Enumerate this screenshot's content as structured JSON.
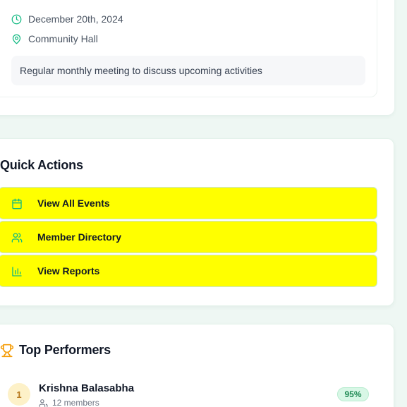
{
  "event": {
    "date": "December 20th, 2024",
    "location": "Community Hall",
    "description": "Regular monthly meeting to discuss upcoming activities"
  },
  "quick_actions": {
    "title": "Quick Actions",
    "items": [
      {
        "label": "View All Events",
        "icon": "calendar-icon"
      },
      {
        "label": "Member Directory",
        "icon": "users-icon"
      },
      {
        "label": "View Reports",
        "icon": "bar-chart-icon"
      }
    ]
  },
  "top_performers": {
    "title": "Top Performers",
    "icon": "trophy-icon",
    "rows": [
      {
        "rank": "1",
        "name": "Krishna Balasabha",
        "members": "12 members",
        "percent": "95%"
      }
    ]
  },
  "colors": {
    "accent": "#10b981",
    "action_bg": "#ffff00",
    "trophy": "#f59e0b",
    "badge_bg": "#d8f7e6"
  }
}
